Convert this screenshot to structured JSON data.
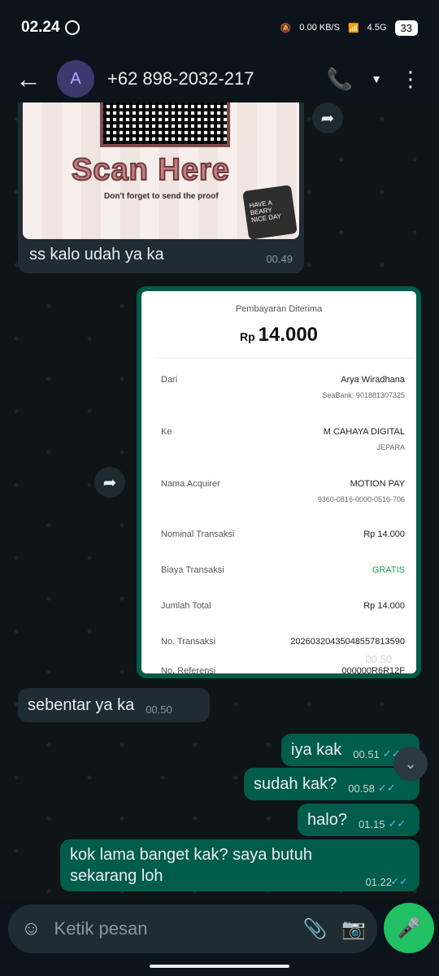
{
  "status_bar": {
    "time": "02.24",
    "net_speed": "0.00 KB/S",
    "network": "4.5G",
    "battery": "33"
  },
  "header": {
    "avatar_letter": "A",
    "contact": "+62 898-2032-217"
  },
  "messages": [
    {
      "id": "m1",
      "dir": "in",
      "type": "image",
      "poster_title": "Scan Here",
      "poster_sub": "Don't forget to send the proof",
      "poster_badge": "HAVE A BEARY NICE DAY",
      "text": "ss kalo udah ya ka",
      "time": "00.49"
    },
    {
      "id": "m2",
      "dir": "out",
      "type": "receipt",
      "time": "00.50"
    },
    {
      "id": "m3",
      "dir": "in",
      "text": "sebentar ya ka",
      "time": "00.50"
    },
    {
      "id": "m4",
      "dir": "out",
      "text": "iya kak",
      "time": "00.51"
    },
    {
      "id": "m5",
      "dir": "out",
      "text": "sudah kak?",
      "time": "00.58"
    },
    {
      "id": "m6",
      "dir": "out",
      "text": "halo?",
      "time": "01.15"
    },
    {
      "id": "m7",
      "dir": "out",
      "text": "kok lama banget kak? saya butuh sekarang loh",
      "time": "01.22"
    }
  ],
  "receipt": {
    "title": "Pembayaran Diterima",
    "currency": "Rp",
    "amount": "14.000",
    "rows": [
      {
        "label": "Dari",
        "value": "Arya Wiradhana",
        "sub": "SeaBank: 901881307325"
      },
      {
        "label": "Ke",
        "value": "M CAHAYA DIGITAL",
        "sub": "JEPARA"
      },
      {
        "label": "Nama Acquirer",
        "value": "MOTION PAY",
        "sub": "9360-0816-0000-0516-706"
      },
      {
        "label": "Nominal Transaksi",
        "value": "Rp 14.000",
        "sub": ""
      },
      {
        "label": "Biaya Transaksi",
        "value": "GRATIS",
        "sub": ""
      },
      {
        "label": "Jumlah Total",
        "value": "Rp 14.000",
        "sub": ""
      },
      {
        "label": "No. Transaksi",
        "value": "20260320435048557813590",
        "sub": ""
      },
      {
        "label": "No. Referensi",
        "value": "000000R6R12F",
        "sub": ""
      }
    ]
  },
  "composer": {
    "placeholder": "Ketik pesan"
  }
}
